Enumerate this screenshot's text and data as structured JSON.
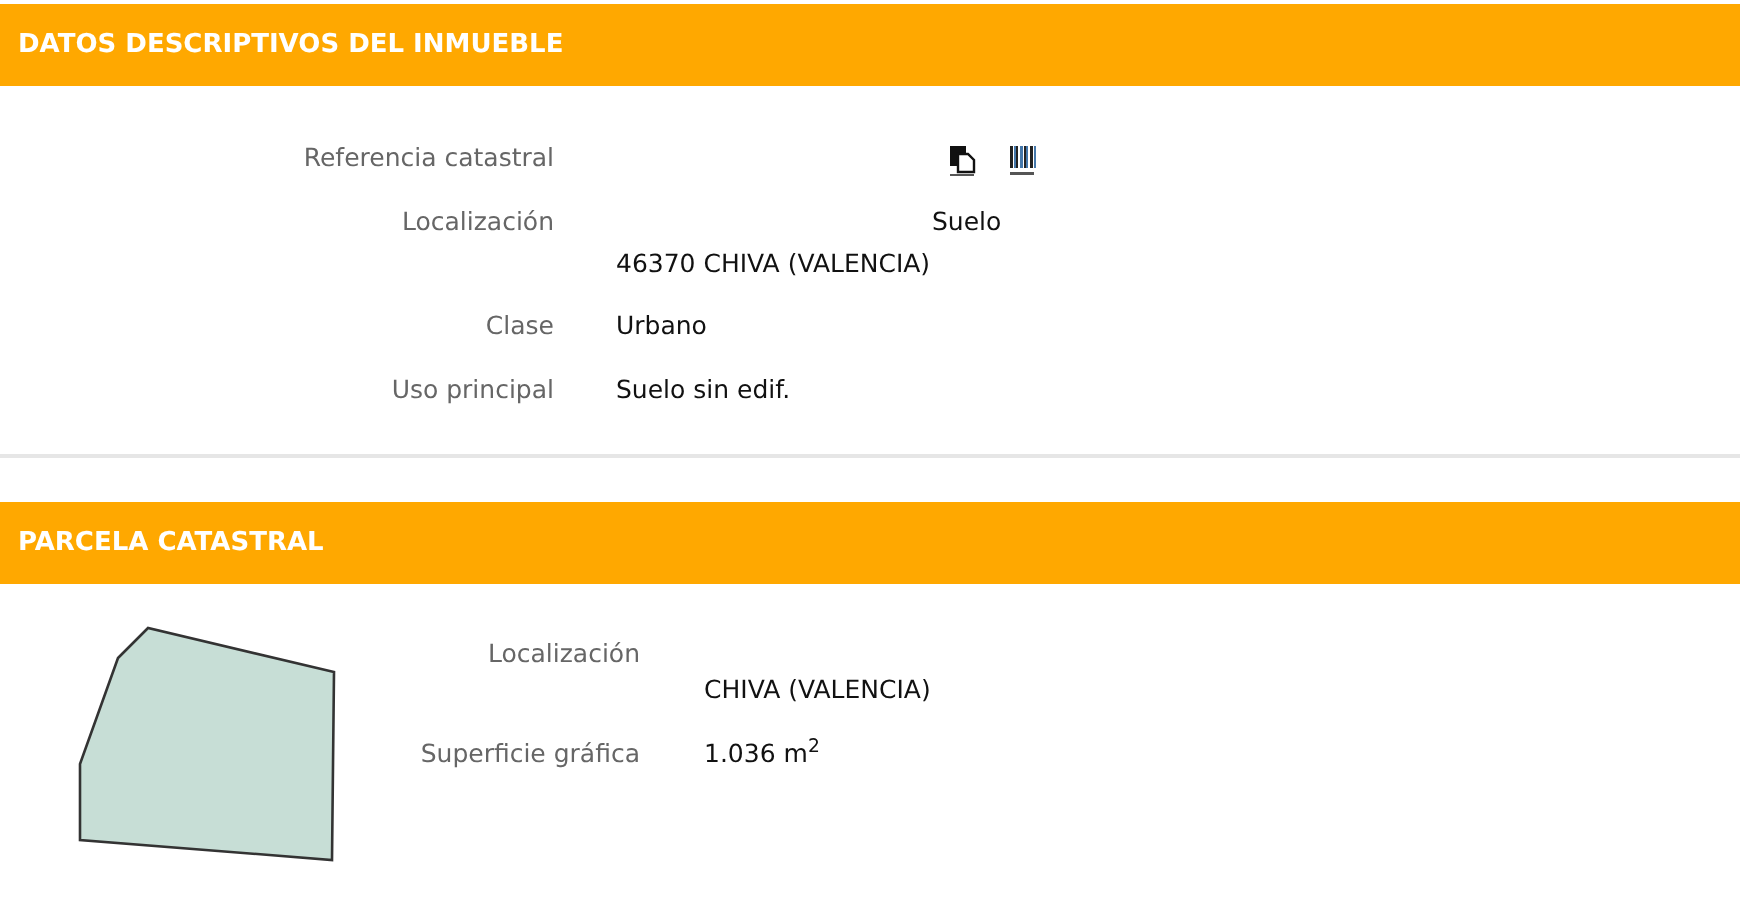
{
  "sections": [
    {
      "title": "DATOS DESCRIPTIVOS DEL INMUEBLE",
      "kind": "fields",
      "rows": [
        {
          "label": "Referencia catastral",
          "kind": "icons"
        },
        {
          "label": "Localización",
          "kind": "address",
          "lines": [
            "Suelo",
            "46370 CHIVA (VALENCIA)"
          ]
        },
        {
          "label": "Clase",
          "kind": "text",
          "lines": [
            "Urbano"
          ]
        },
        {
          "label": "Uso principal",
          "kind": "text",
          "lines": [
            "Suelo sin edif."
          ]
        }
      ]
    },
    {
      "title": "PARCELA CATASTRAL",
      "kind": "parcel",
      "rows": [
        {
          "label": "Localización",
          "kind": "address",
          "lines": [
            "CHIVA (VALENCIA)"
          ]
        },
        {
          "label": "Superficie gráfica",
          "kind": "text",
          "lines": [
            "1.036 m$^{2}$"
          ]
        }
      ]
    }
  ]
}
